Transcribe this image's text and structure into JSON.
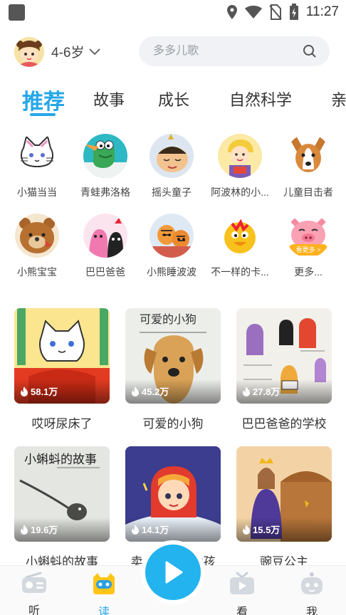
{
  "status_bar": {
    "time": "11:27",
    "icons": [
      "location-icon",
      "wifi-icon",
      "no-sim-icon",
      "battery-charging-icon"
    ]
  },
  "header": {
    "age_label": "4-6岁",
    "search_placeholder": "多多儿歌"
  },
  "tabs": [
    {
      "label": "推荐",
      "active": true
    },
    {
      "label": "故事",
      "active": false
    },
    {
      "label": "成长",
      "active": false
    },
    {
      "label": "自然科学",
      "active": false
    },
    {
      "label": "亲",
      "active": false
    }
  ],
  "categories": [
    {
      "label": "小猫当当"
    },
    {
      "label": "青蛙弗洛格"
    },
    {
      "label": "摇头童子"
    },
    {
      "label": "阿波林的小..."
    },
    {
      "label": "儿童目击者"
    },
    {
      "label": "小熊宝宝"
    },
    {
      "label": "巴巴爸爸"
    },
    {
      "label": "小熊睡波波"
    },
    {
      "label": "不一样的卡..."
    },
    {
      "label": "更多...",
      "badge": "看更多 >"
    }
  ],
  "books": [
    {
      "title": "哎呀尿床了",
      "plays": "58.1万",
      "cover_text": ""
    },
    {
      "title": "可爱的小狗",
      "plays": "45.2万",
      "cover_text": "可爱的小狗"
    },
    {
      "title": "巴巴爸爸的学校",
      "plays": "27.8万",
      "cover_text": ""
    },
    {
      "title": "小蝌蚪的故事",
      "plays": "19.6万",
      "cover_text": "小蝌蚪的故事"
    },
    {
      "title": "卖火柴的小女孩",
      "plays": "14.1万",
      "cover_text": ""
    },
    {
      "title": "豌豆公主",
      "plays": "15.5万",
      "cover_text": ""
    }
  ],
  "bottom_nav": [
    {
      "label": "听",
      "icon": "radio-icon",
      "active": false
    },
    {
      "label": "读",
      "icon": "book-face-icon",
      "active": true
    },
    {
      "label": "看",
      "icon": "tv-icon",
      "active": false
    },
    {
      "label": "我",
      "icon": "robot-face-icon",
      "active": false
    }
  ],
  "colors": {
    "accent": "#25a7e8",
    "play_button": "#23b3ee"
  }
}
